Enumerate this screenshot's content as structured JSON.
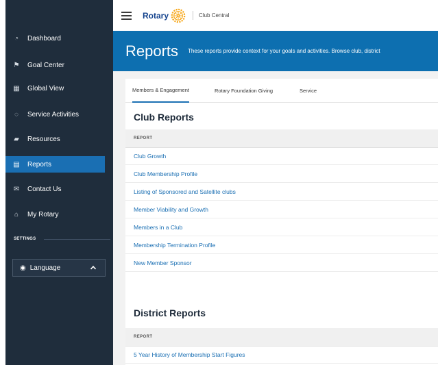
{
  "sidebar": {
    "items": [
      {
        "label": "Dashboard",
        "icon": "gauge-icon",
        "glyph": "◔"
      },
      {
        "label": "Goal Center",
        "icon": "flag-icon",
        "glyph": "⚑"
      },
      {
        "label": "Global View",
        "icon": "grid-icon",
        "glyph": "▦"
      },
      {
        "label": "Service Activities",
        "icon": "handshake-icon",
        "glyph": "◌"
      },
      {
        "label": "Resources",
        "icon": "book-icon",
        "glyph": "▰"
      },
      {
        "label": "Reports",
        "icon": "document-icon",
        "glyph": "▤",
        "active": true
      },
      {
        "label": "Contact Us",
        "icon": "envelope-icon",
        "glyph": "✉"
      },
      {
        "label": "My Rotary",
        "icon": "home-icon",
        "glyph": "⌂"
      }
    ],
    "settings_label": "SETTINGS",
    "language_label": "Language",
    "language_icon_glyph": "◉"
  },
  "header": {
    "brand": "Rotary",
    "product": "Club Central"
  },
  "hero": {
    "title": "Reports",
    "description": "These reports provide context for your goals and activities. Browse club, district"
  },
  "tabs": [
    {
      "label": "Members & Engagement",
      "active": true
    },
    {
      "label": "Rotary Foundation Giving",
      "active": false
    },
    {
      "label": "Service",
      "active": false
    }
  ],
  "club_reports": {
    "title": "Club Reports",
    "column_header": "REPORT",
    "rows": [
      "Club Growth",
      "Club Membership Profile",
      "Listing of Sponsored and Satellite clubs",
      "Member Viability and Growth",
      "Members in a Club",
      "Membership Termination Profile",
      "New Member Sponsor"
    ]
  },
  "district_reports": {
    "title": "District Reports",
    "column_header": "REPORT",
    "rows": [
      "5 Year History of Membership Start Figures"
    ]
  },
  "colors": {
    "sidebar_bg": "#1f2d3c",
    "accent_blue": "#1a6fb3",
    "hero_blue": "#0d6fb0",
    "rotary_navy": "#17458f",
    "rotary_gold": "#f7a81b"
  }
}
